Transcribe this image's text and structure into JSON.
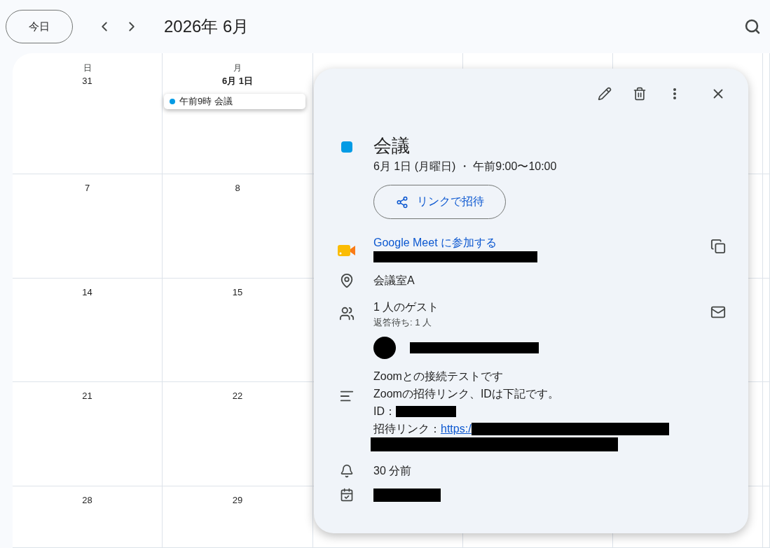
{
  "toolbar": {
    "today_button": "今日",
    "month_title": "2026年 6月"
  },
  "calendar": {
    "weekdays": [
      "日",
      "月"
    ],
    "weeks": [
      {
        "days": [
          {
            "label": "31",
            "emphasis": false
          },
          {
            "label": "6月 1日",
            "emphasis": true,
            "events": [
              {
                "label": "午前9時 会議",
                "color": "#039be5",
                "selected": true
              }
            ]
          }
        ]
      },
      {
        "days": [
          {
            "label": "7",
            "emphasis": false
          },
          {
            "label": "8",
            "emphasis": false
          }
        ]
      },
      {
        "days": [
          {
            "label": "14",
            "emphasis": false
          },
          {
            "label": "15",
            "emphasis": false
          }
        ]
      },
      {
        "days": [
          {
            "label": "21",
            "emphasis": false
          },
          {
            "label": "22",
            "emphasis": false
          }
        ]
      },
      {
        "days": [
          {
            "label": "28",
            "emphasis": false
          },
          {
            "label": "29",
            "emphasis": false
          }
        ]
      }
    ]
  },
  "event_popup": {
    "color": "#039be5",
    "title": "会議",
    "datetime": "6月 1日 (月曜日) ・ 午前9:00〜10:00",
    "invite_button": "リンクで招待",
    "meet_link": "Google Meet に参加する",
    "location": "会議室A",
    "guests_title": "1 人のゲスト",
    "guests_status": "返答待ち: 1 人",
    "description": {
      "line_1": "Zoomとの接続テストです",
      "line_2": "Zoomの招待リンク、IDは下記です。",
      "id_label": "ID：",
      "link_label": "招待リンク：",
      "link_text": "https:/"
    },
    "reminder": "30 分前"
  }
}
